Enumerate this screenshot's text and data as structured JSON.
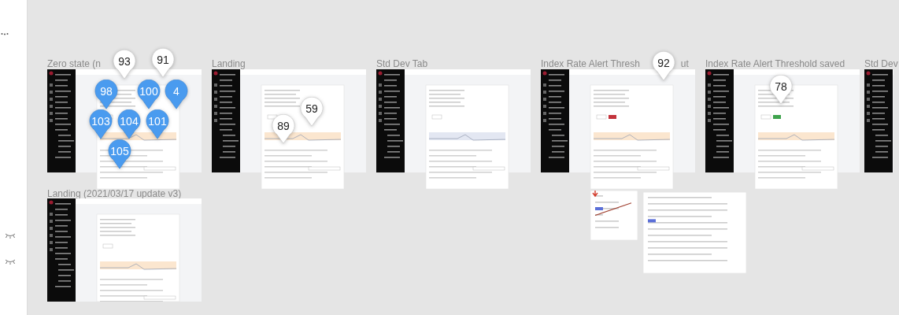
{
  "frames": [
    {
      "label": "Zero state (n"
    },
    {
      "label": "Landing"
    },
    {
      "label": "Std Dev Tab"
    },
    {
      "label": "Index Rate Alert Thresh",
      "label_end": "ut"
    },
    {
      "label": "Index Rate Alert Threshold saved"
    },
    {
      "label": "Std Dev"
    },
    {
      "label": "Landing (2021/03/17 update v3)"
    }
  ],
  "comment_pins": [
    {
      "label": "93",
      "selected": false
    },
    {
      "label": "91",
      "selected": false
    },
    {
      "label": "98",
      "selected": true
    },
    {
      "label": "100",
      "selected": true
    },
    {
      "label": "4",
      "selected": true
    },
    {
      "label": "103",
      "selected": true
    },
    {
      "label": "104",
      "selected": true
    },
    {
      "label": "101",
      "selected": true
    },
    {
      "label": "105",
      "selected": true
    },
    {
      "label": "89",
      "selected": false
    },
    {
      "label": "59",
      "selected": false
    },
    {
      "label": "92",
      "selected": false
    },
    {
      "label": "78",
      "selected": false
    }
  ]
}
